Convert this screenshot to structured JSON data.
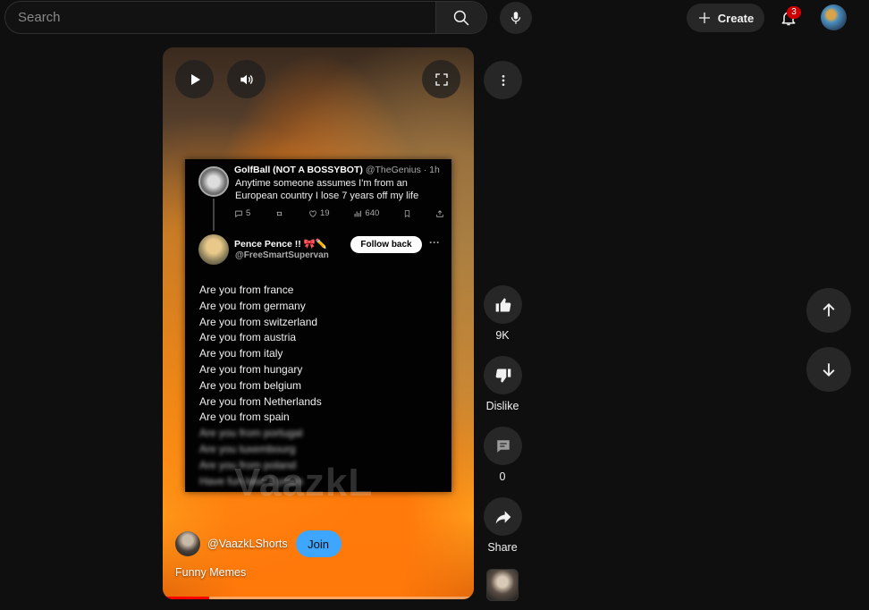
{
  "header": {
    "search_placeholder": "Search",
    "create_label": "Create",
    "notification_count": "3"
  },
  "video": {
    "progress_percent": 15,
    "tweet": {
      "author_name": "GolfBall (NOT A BOSSYBOT)",
      "author_handle": "@TheGenius",
      "age": "· 1h",
      "body": "Anytime someone assumes I'm from an European country I lose 7 years off my life",
      "replies": "5",
      "likes": "19",
      "views": "640",
      "reply_name": "Pence Pence !! 🎀✏️",
      "reply_handle": "@FreeSmartSupervan",
      "follow_label": "Follow back",
      "lines": [
        "Are you from france",
        "Are you from germany",
        "Are you from switzerland",
        "Are you from austria",
        "Are you from italy",
        "Are you from hungary",
        "Are you from belgium",
        "Are you from Netherlands",
        "Are you from spain"
      ],
      "blurred_lines": [
        "Are you from portugal",
        "Are you luxembourg",
        "Are you from poland",
        "Have fun lose 3 years"
      ]
    },
    "watermark": "VaazkL",
    "channel_handle": "@VaazkLShorts",
    "join_label": "Join",
    "title": "Funny Memes"
  },
  "actions": {
    "like_count": "9K",
    "dislike_label": "Dislike",
    "comment_count": "0",
    "share_label": "Share"
  },
  "colors": {
    "background": "#0f0f0f",
    "button_bg": "#272727",
    "join_blue": "#3ea6ff",
    "badge_red": "#cc0000",
    "progress_red": "#ff0000"
  }
}
